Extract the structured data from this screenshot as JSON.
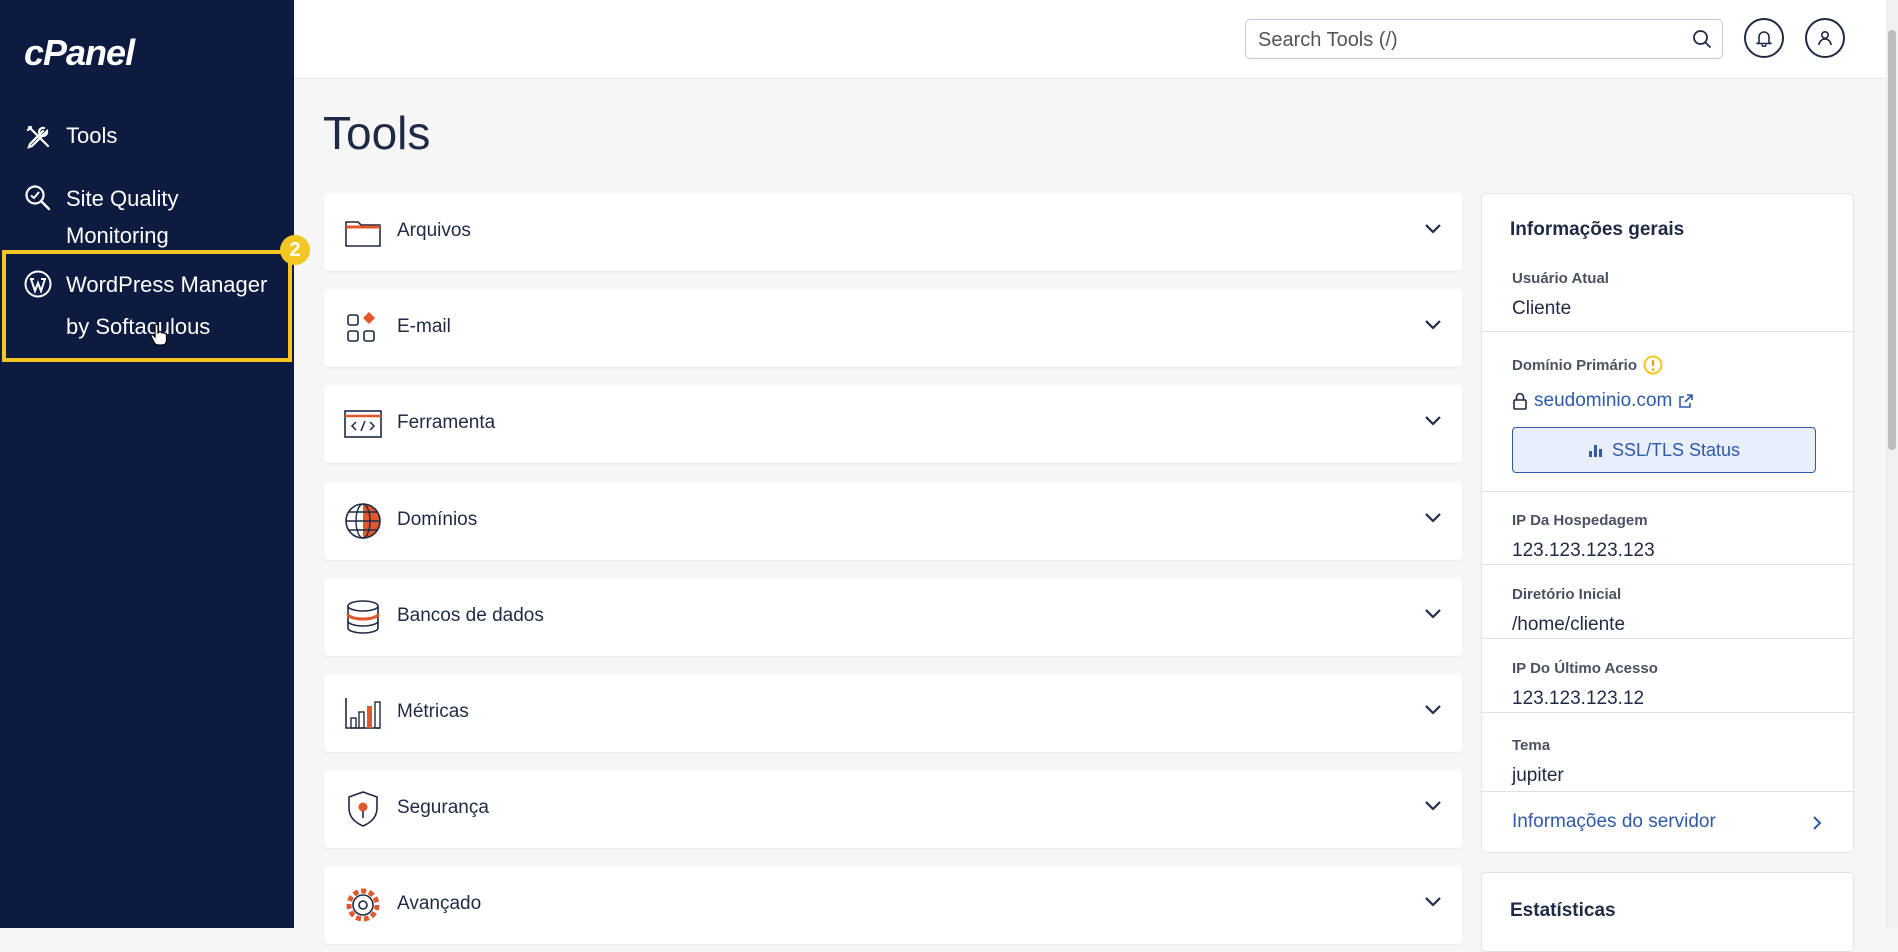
{
  "sidebar": {
    "logo": "cPanel",
    "items": [
      {
        "label": "Tools",
        "icon": "tools-icon"
      },
      {
        "label": "Site Quality Monitoring",
        "icon": "search-magnifier-icon"
      },
      {
        "label": "WordPress Manager by Softaculous",
        "icon": "wordpress-icon"
      }
    ],
    "highlight_badge": "2"
  },
  "topbar": {
    "search_placeholder": "Search Tools (/)"
  },
  "main": {
    "title": "Tools",
    "panels": [
      {
        "label": "Arquivos",
        "icon": "folder-icon"
      },
      {
        "label": "E-mail",
        "icon": "email-apps-icon"
      },
      {
        "label": "Ferramenta",
        "icon": "code-window-icon"
      },
      {
        "label": "Domínios",
        "icon": "globe-icon"
      },
      {
        "label": "Bancos de dados",
        "icon": "database-icon"
      },
      {
        "label": "Métricas",
        "icon": "bar-chart-icon"
      },
      {
        "label": "Segurança",
        "icon": "shield-icon"
      },
      {
        "label": "Avançado",
        "icon": "gear-icon"
      }
    ]
  },
  "info": {
    "title": "Informações gerais",
    "current_user_label": "Usuário Atual",
    "current_user": "Cliente",
    "primary_domain_label": "Domínio Primário",
    "primary_domain": "seudominio.com",
    "ssl_button": "SSL/TLS Status",
    "hosting_ip_label": "IP Da Hospedagem",
    "hosting_ip": "123.123.123.123",
    "home_dir_label": "Diretório Inicial",
    "home_dir": "/home/cliente",
    "last_ip_label": "IP Do Último Acesso",
    "last_ip": "123.123.123.12",
    "theme_label": "Tema",
    "theme": "jupiter",
    "server_info_link": "Informações do servidor"
  },
  "stats": {
    "title": "Estatísticas"
  },
  "colors": {
    "sidebar_bg": "#0e1b40",
    "highlight": "#f3c623",
    "accent_orange": "#e2572b",
    "link_blue": "#2f5aa8"
  }
}
